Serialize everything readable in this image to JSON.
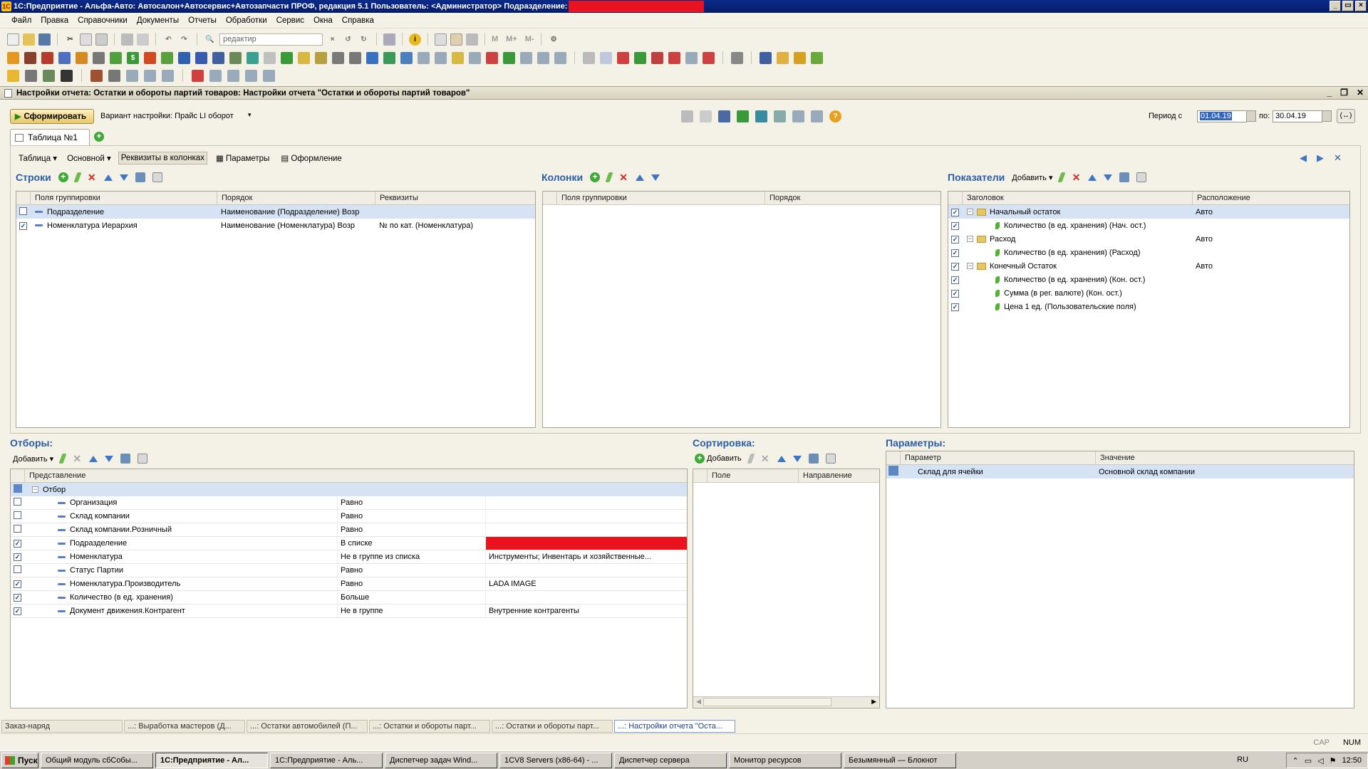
{
  "window": {
    "title": "1С:Предприятие - Альфа-Авто: Автосалон+Автосервис+Автозапчасти ПРОФ, редакция 5.1   Пользователь: <Администратор>   Подразделение:",
    "controls": [
      "_",
      "▭",
      "×"
    ]
  },
  "menu": [
    "Файл",
    "Правка",
    "Справочники",
    "Документы",
    "Отчеты",
    "Обработки",
    "Сервис",
    "Окна",
    "Справка"
  ],
  "toolbar": {
    "search_value": "редактир",
    "memory": [
      "M",
      "M+",
      "M-"
    ]
  },
  "document": {
    "title": "Настройки отчета: Остатки и обороты партий товаров: Настройки отчета \"Остатки и обороты партий товаров\""
  },
  "actions": {
    "generate": "Сформировать",
    "variant_label": "Вариант настройки: Прайс LI оборот",
    "period_label": "Период с",
    "period_from": "01.04.19",
    "period_to_label": "по:",
    "period_to": "30.04.19"
  },
  "tab": {
    "label": "Таблица №1"
  },
  "subtabs": [
    "Таблица",
    "Основной",
    "Реквизиты в колонках",
    "Параметры",
    "Оформление"
  ],
  "rows_section": {
    "title": "Строки",
    "headers": [
      "Поля группировки",
      "Порядок",
      "Реквизиты"
    ],
    "items": [
      {
        "checked": false,
        "field": "Подразделение",
        "order": "Наименование (Подразделение) Возр",
        "attrs": ""
      },
      {
        "checked": true,
        "field": "Номенклатура Иерархия",
        "order": "Наименование (Номенклатура) Возр",
        "attrs": "№ по кат. (Номенклатура)"
      }
    ]
  },
  "columns_section": {
    "title": "Колонки",
    "headers": [
      "Поля группировки",
      "Порядок"
    ]
  },
  "indicators_section": {
    "title": "Показатели",
    "add": "Добавить",
    "headers": [
      "Заголовок",
      "Расположение"
    ],
    "items": [
      {
        "type": "folder",
        "label": "Начальный остаток",
        "place": "Авто"
      },
      {
        "type": "leaf",
        "label": "Количество (в ед. хранения) (Нач. ост.)",
        "place": ""
      },
      {
        "type": "folder",
        "label": "Расход",
        "place": "Авто"
      },
      {
        "type": "leaf",
        "label": "Количество (в ед. хранения) (Расход)",
        "place": ""
      },
      {
        "type": "folder",
        "label": "Конечный Остаток",
        "place": "Авто"
      },
      {
        "type": "leaf",
        "label": "Количество (в ед. хранения) (Кон. ост.)",
        "place": ""
      },
      {
        "type": "leaf",
        "label": "Сумма (в рег. валюте) (Кон. ост.)",
        "place": ""
      },
      {
        "type": "leaf",
        "label": "Цена 1 ед. (Пользовательские поля)",
        "place": ""
      }
    ]
  },
  "filters_section": {
    "title": "Отборы:",
    "add": "Добавить",
    "header": "Представление",
    "group": "Отбор",
    "items": [
      {
        "checked": false,
        "field": "Организация",
        "cond": "Равно",
        "value": ""
      },
      {
        "checked": false,
        "field": "Склад компании",
        "cond": "Равно",
        "value": ""
      },
      {
        "checked": false,
        "field": "Склад компании.Розничный",
        "cond": "Равно",
        "value": ""
      },
      {
        "checked": true,
        "field": "Подразделение",
        "cond": "В списке",
        "value": "",
        "redacted": true
      },
      {
        "checked": true,
        "field": "Номенклатура",
        "cond": "Не в группе из списка",
        "value": "Инструменты; Инвентарь и хозяйственные..."
      },
      {
        "checked": false,
        "field": "Статус Партии",
        "cond": "Равно",
        "value": ""
      },
      {
        "checked": true,
        "field": "Номенклатура.Производитель",
        "cond": "Равно",
        "value": "LADA IMAGE"
      },
      {
        "checked": true,
        "field": "Количество (в ед. хранения)",
        "cond": "Больше",
        "value": ""
      },
      {
        "checked": true,
        "field": "Документ движения.Контрагент",
        "cond": "Не в группе",
        "value": "Внутренние контрагенты"
      }
    ]
  },
  "sort_section": {
    "title": "Сортировка:",
    "add": "Добавить",
    "headers": [
      "Поле",
      "Направление"
    ]
  },
  "params_section": {
    "title": "Параметры:",
    "headers": [
      "Параметр",
      "Значение"
    ],
    "items": [
      {
        "param": "Склад для ячейки",
        "value": "Основной склад компании"
      }
    ]
  },
  "window_tabs": [
    "Заказ-наряд",
    "...: Выработка мастеров (Д...",
    "...: Остатки автомобилей (П...",
    "...: Остатки и обороты парт...",
    "...: Остатки и обороты парт...",
    "...: Настройки отчета \"Оста..."
  ],
  "status": {
    "cap": "CAP",
    "num": "NUM"
  },
  "taskbar": {
    "start": "Пуск",
    "tasks": [
      "Общий модуль сбСобы...",
      "1С:Предприятие - Ал...",
      "1С:Предприятие - Аль...",
      "Диспетчер задач Wind...",
      "1CV8 Servers (x86-64) - ...",
      "Диспетчер сервера",
      "Монитор ресурсов",
      "Безымянный — Блокнот"
    ],
    "lang": "RU",
    "time": "12:50"
  },
  "colors": {
    "title_bg": "#0b2a8a",
    "section_title": "#2b5ca6",
    "selection": "#d5e3f5",
    "redaction": "#e8131c"
  }
}
